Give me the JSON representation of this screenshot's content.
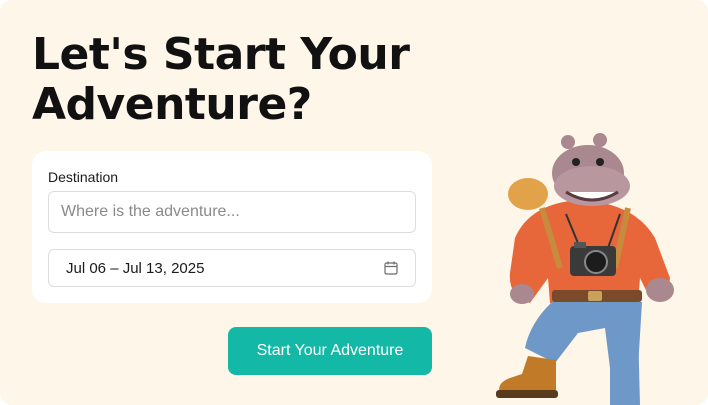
{
  "hero": {
    "title": "Let's Start Your Adventure?"
  },
  "form": {
    "destination_label": "Destination",
    "destination_placeholder": "Where is the adventure...",
    "destination_value": "",
    "date_range": "Jul 06 – Jul 13, 2025",
    "calendar_icon": "calendar-icon"
  },
  "actions": {
    "start_label": "Start Your Adventure"
  },
  "colors": {
    "background": "#fdf6e9",
    "accent": "#14b8a6",
    "card": "#ffffff"
  },
  "illustration": {
    "name": "hippo-explorer-mascot"
  }
}
